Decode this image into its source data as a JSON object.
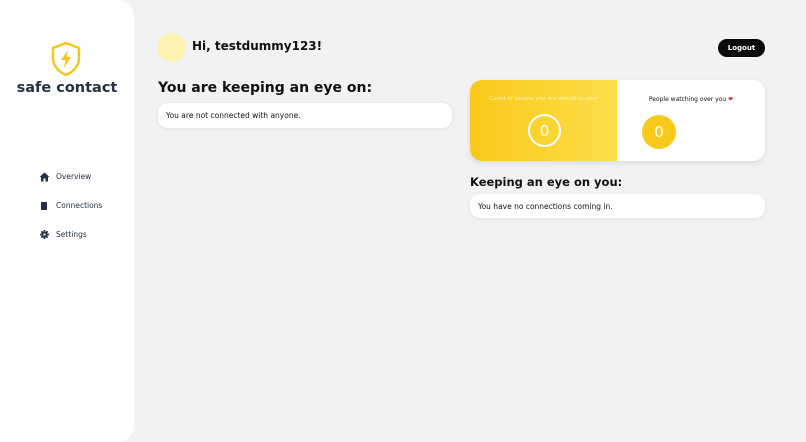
{
  "sidebar": {
    "brand": "safe contact",
    "items": [
      {
        "label": "Overview",
        "icon": "home-icon"
      },
      {
        "label": "Connections",
        "icon": "document-icon"
      },
      {
        "label": "Settings",
        "icon": "gear-icon"
      }
    ]
  },
  "header": {
    "greeting": "Hi, testdummy123!",
    "logout_label": "Logout"
  },
  "watching": {
    "title": "You are keeping an eye on:",
    "empty_message": "You are not connected with anyone."
  },
  "stats": {
    "watching_label": "Count of people you are watching over",
    "watching_count": "0",
    "watchers_label": "People watching over you",
    "watchers_count": "0"
  },
  "incoming": {
    "title": "Keeping an eye on you:",
    "empty_message": "You have no connections coming in."
  },
  "colors": {
    "accent": "#f8c91a",
    "background": "#f1f2f4",
    "sidebar": "#ffffff",
    "button": "#0b0b0b"
  }
}
